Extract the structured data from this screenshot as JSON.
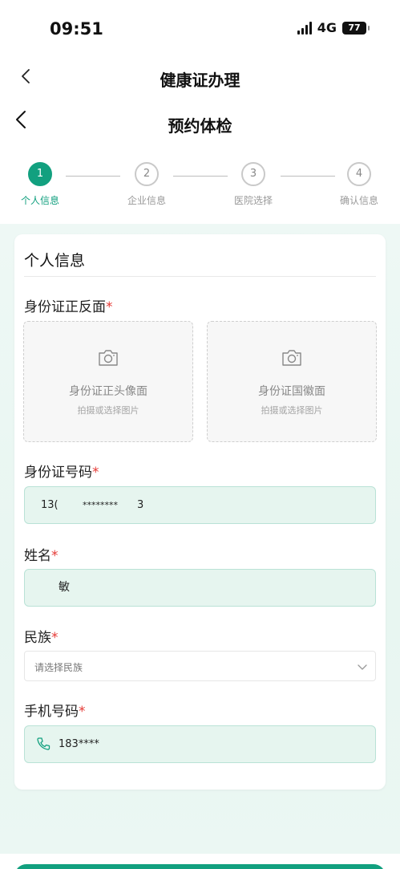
{
  "status_bar": {
    "time": "09:51",
    "network": "4G",
    "battery": "77",
    "icons": [
      "signal-icon",
      "battery-icon"
    ]
  },
  "nav": {
    "outer_title": "健康证办理",
    "inner_title": "预约体检",
    "back_icon": "chevron-left-icon"
  },
  "stepper": {
    "steps": [
      {
        "number": "1",
        "label": "个人信息",
        "active": true
      },
      {
        "number": "2",
        "label": "企业信息",
        "active": false
      },
      {
        "number": "3",
        "label": "医院选择",
        "active": false
      },
      {
        "number": "4",
        "label": "确认信息",
        "active": false
      }
    ]
  },
  "form": {
    "section_title": "个人信息",
    "required_mark": "*",
    "id_card": {
      "label": "身份证正反面",
      "front": {
        "title": "身份证正头像面",
        "hint": "拍摄或选择图片",
        "icon": "camera-icon"
      },
      "back": {
        "title": "身份证国徽面",
        "hint": "拍摄或选择图片",
        "icon": "camera-icon"
      }
    },
    "id_number": {
      "label": "身份证号码",
      "prefix": "13(",
      "masked": "********",
      "suffix": "3"
    },
    "name": {
      "label": "姓名",
      "value": "敏"
    },
    "ethnicity": {
      "label": "民族",
      "placeholder": "请选择民族",
      "icon": "chevron-down-icon"
    },
    "phone": {
      "label": "手机号码",
      "value": "183****",
      "icon": "phone-icon"
    }
  },
  "colors": {
    "accent": "#12a07f",
    "input_bg": "#e6f5ef",
    "required": "#e53935",
    "page_bg": "#eef8f5"
  }
}
